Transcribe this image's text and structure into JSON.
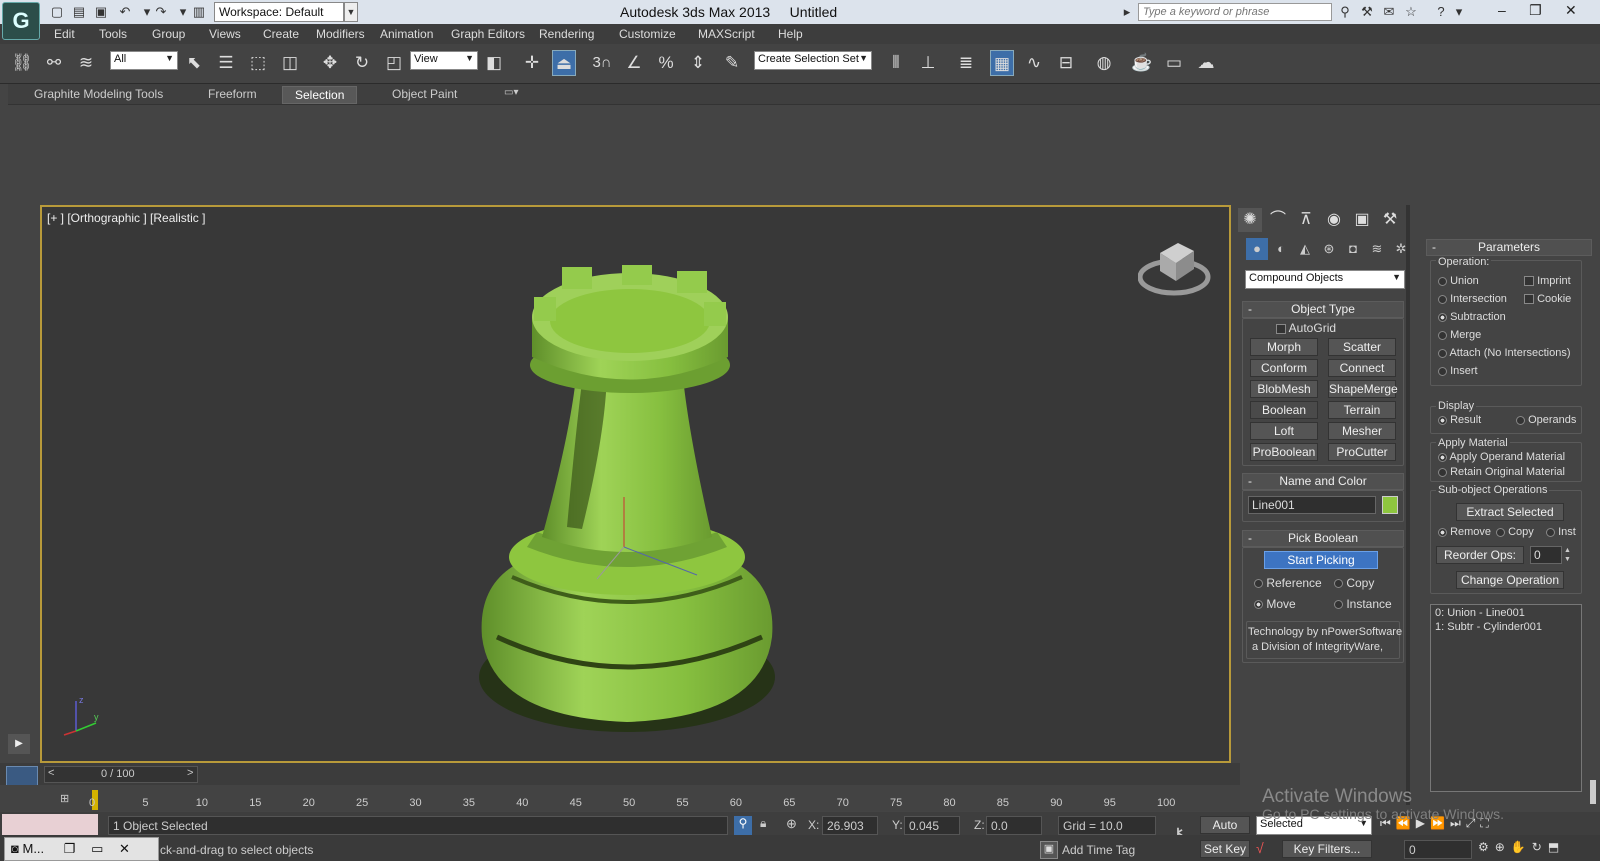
{
  "titlebar": {
    "title": "Autodesk 3ds Max  2013",
    "document": "Untitled",
    "workspace": "Workspace: Default",
    "search_placeholder": "Type a keyword or phrase"
  },
  "menu": {
    "items": [
      "Edit",
      "Tools",
      "Group",
      "Views",
      "Create",
      "Modifiers",
      "Animation",
      "Graph Editors",
      "Rendering",
      "Customize",
      "MAXScript",
      "Help"
    ]
  },
  "toolbar": {
    "filter": "All",
    "coord": "View",
    "snap_angle": "3",
    "selection_set": "Create Selection Set"
  },
  "ribbon": {
    "tabs": [
      "Graphite Modeling Tools",
      "Freeform",
      "Selection",
      "Object Paint"
    ],
    "active": "Selection"
  },
  "viewport": {
    "label": "[+ ] [Orthographic ] [Realistic ]",
    "object_color": "#8ec63f"
  },
  "command_panel": {
    "category": "Compound Objects",
    "object_type": {
      "header": "Object Type",
      "autogrid": "AutoGrid",
      "buttons": [
        "Morph",
        "Scatter",
        "Conform",
        "Connect",
        "BlobMesh",
        "ShapeMerge",
        "Boolean",
        "Terrain",
        "Loft",
        "Mesher",
        "ProBoolean",
        "ProCutter"
      ]
    },
    "name_color": {
      "header": "Name and Color",
      "name": "Line001",
      "swatch": "#8ec63f"
    },
    "pick_boolean": {
      "header": "Pick Boolean",
      "start": "Start Picking",
      "reference": "Reference",
      "copy": "Copy",
      "move": "Move",
      "instance": "Instance"
    },
    "credit_line1": "Technology by nPowerSoftware",
    "credit_line2": "a Division of IntegrityWare,"
  },
  "parameters": {
    "header": "Parameters",
    "operation_label": "Operation:",
    "union": "Union",
    "intersection": "Intersection",
    "subtraction": "Subtraction",
    "merge": "Merge",
    "attach": "Attach (No Intersections)",
    "insert": "Insert",
    "imprint": "Imprint",
    "cookie": "Cookie",
    "display_label": "Display",
    "result": "Result",
    "operands": "Operands",
    "apply_material_label": "Apply Material",
    "apply_operand": "Apply Operand Material",
    "retain_original": "Retain Original Material",
    "subobject_label": "Sub-object Operations",
    "extract": "Extract Selected",
    "remove": "Remove",
    "copy": "Copy",
    "inst": "Inst",
    "reorder_label": "Reorder Ops:",
    "reorder_value": "0",
    "change_op": "Change Operation",
    "list": [
      "0: Union - Line001",
      "1: Subtr - Cylinder001"
    ]
  },
  "timeline": {
    "frame": "0 / 100",
    "ticks": [
      "0",
      "5",
      "10",
      "15",
      "20",
      "25",
      "30",
      "35",
      "40",
      "45",
      "50",
      "55",
      "60",
      "65",
      "70",
      "75",
      "80",
      "85",
      "90",
      "95",
      "100"
    ]
  },
  "status": {
    "selected": "1 Object Selected",
    "prompt": "ck-and-drag to select objects",
    "x_label": "X:",
    "x": "26.903",
    "y_label": "Y:",
    "y": "0.045",
    "z_label": "Z:",
    "z": "0.0",
    "grid": "Grid = 10.0",
    "add_time_tag": "Add Time Tag",
    "auto_key": "Auto Key",
    "set_key": "Set Key",
    "key_mode": "Selected",
    "key_filters": "Key Filters...",
    "frame_field": "0"
  },
  "taskbar": {
    "app": "M..."
  },
  "watermark": {
    "line1": "Activate Windows",
    "line2": "Go to PC settings to activate Windows."
  }
}
